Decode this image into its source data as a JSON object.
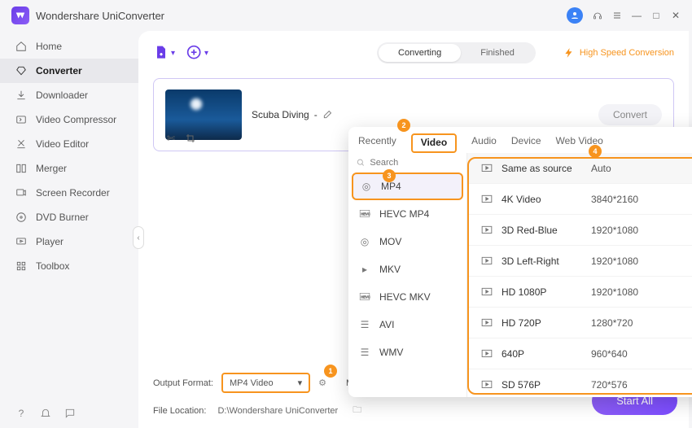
{
  "app_title": "Wondershare UniConverter",
  "titlebar_icons": {
    "minimize": "—",
    "maximize": "□",
    "close": "✕"
  },
  "sidebar": [
    {
      "icon": "home",
      "label": "Home"
    },
    {
      "icon": "converter",
      "label": "Converter"
    },
    {
      "icon": "downloader",
      "label": "Downloader"
    },
    {
      "icon": "compressor",
      "label": "Video Compressor"
    },
    {
      "icon": "editor",
      "label": "Video Editor"
    },
    {
      "icon": "merger",
      "label": "Merger"
    },
    {
      "icon": "recorder",
      "label": "Screen Recorder"
    },
    {
      "icon": "dvd",
      "label": "DVD Burner"
    },
    {
      "icon": "player",
      "label": "Player"
    },
    {
      "icon": "toolbox",
      "label": "Toolbox"
    }
  ],
  "segmented": {
    "converting": "Converting",
    "finished": "Finished"
  },
  "high_speed": "High Speed Conversion",
  "file": {
    "name": "Scuba Diving ",
    "dash": "-"
  },
  "convert_button": "Convert",
  "popup_tabs": [
    "Recently",
    "Video",
    "Audio",
    "Device",
    "Web Video"
  ],
  "search_placeholder": "Search",
  "formats": [
    "MP4",
    "HEVC MP4",
    "MOV",
    "MKV",
    "HEVC MKV",
    "AVI",
    "WMV"
  ],
  "resolutions": [
    {
      "label": "Same as source",
      "res": "Auto"
    },
    {
      "label": "4K Video",
      "res": "3840*2160"
    },
    {
      "label": "3D Red-Blue",
      "res": "1920*1080"
    },
    {
      "label": "3D Left-Right",
      "res": "1920*1080"
    },
    {
      "label": "HD 1080P",
      "res": "1920*1080"
    },
    {
      "label": "HD 720P",
      "res": "1280*720"
    },
    {
      "label": "640P",
      "res": "960*640"
    },
    {
      "label": "SD 576P",
      "res": "720*576"
    }
  ],
  "callouts": {
    "one": "1",
    "two": "2",
    "three": "3",
    "four": "4"
  },
  "footer": {
    "output_format_label": "Output Format:",
    "output_format_value": "MP4 Video",
    "merge_label": "Merge All Files:",
    "file_location_label": "File Location:",
    "file_location_value": "D:\\Wondershare UniConverter"
  },
  "start_all": "Start All"
}
